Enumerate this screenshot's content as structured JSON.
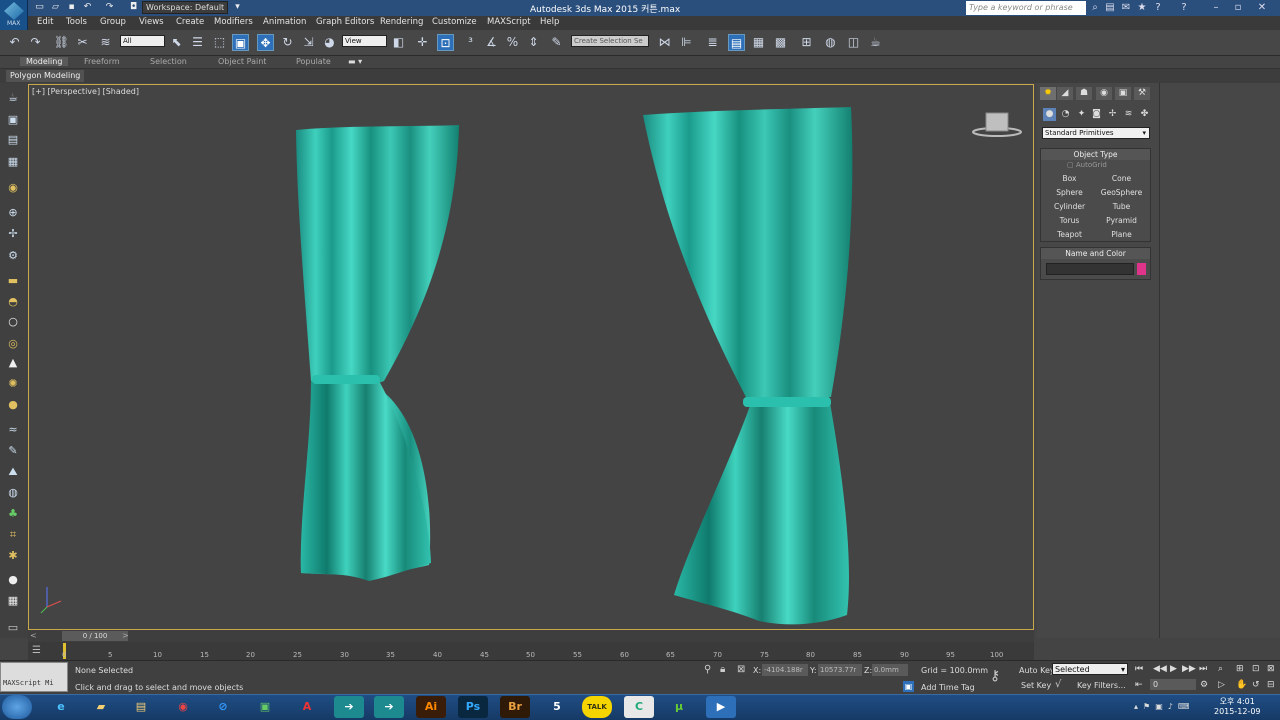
{
  "titlebar": {
    "app_icon_label": "MAX",
    "workspace": "Workspace: Default",
    "title": "Autodesk 3ds Max  2015     커튼.max",
    "search_placeholder": "Type a keyword or phrase"
  },
  "menubar": {
    "items": [
      "Edit",
      "Tools",
      "Group",
      "Views",
      "Create",
      "Modifiers",
      "Animation",
      "Graph Editors",
      "Rendering",
      "Customize",
      "MAXScript",
      "Help"
    ]
  },
  "toolbar": {
    "selection_filter": "All",
    "ref_coord": "View",
    "named_selection": "Create Selection Se"
  },
  "ribbon": {
    "tabs": [
      "Modeling",
      "Freeform",
      "Selection",
      "Object Paint",
      "Populate"
    ],
    "active_tab": "Modeling",
    "subtab": "Polygon Modeling"
  },
  "viewport": {
    "label": "[+] [Perspective] [Shaded]",
    "viewcube_label": "Right"
  },
  "command_panel": {
    "category": "Standard Primitives",
    "object_type_header": "Object Type",
    "autogrid": "AutoGrid",
    "buttons": [
      "Box",
      "Cone",
      "Sphere",
      "GeoSphere",
      "Cylinder",
      "Tube",
      "Torus",
      "Pyramid",
      "Teapot",
      "Plane"
    ],
    "name_color_header": "Name and Color",
    "swatch_color": "#e0338a"
  },
  "timeline": {
    "frame_indicator": "0 / 100",
    "ticks": [
      "0",
      "5",
      "10",
      "15",
      "20",
      "25",
      "30",
      "35",
      "40",
      "45",
      "50",
      "55",
      "60",
      "65",
      "70",
      "75",
      "80",
      "85",
      "90",
      "95",
      "100"
    ]
  },
  "status": {
    "selection": "None Selected",
    "prompt": "Click and drag to select and move objects",
    "maxscript": "MAXScript Mi",
    "x_label": "X:",
    "x_value": "-4104.188r",
    "y_label": "Y:",
    "y_value": "10573.77r",
    "z_label": "Z:",
    "z_value": "0.0mm",
    "grid": "Grid = 100.0mm",
    "add_time_tag": "Add Time Tag",
    "auto_key": "Auto Key",
    "key_mode": "Selected",
    "set_key": "Set Key",
    "key_filters": "Key Filters...",
    "frame_value": "0"
  },
  "taskbar": {
    "apps": [
      "IE",
      "Explorer",
      "Files",
      "Chrome",
      "Outlook",
      "Evernote",
      "Acrobat",
      "3ds",
      "3ds",
      "Ai",
      "Ps",
      "Br",
      "5",
      "Talk",
      "Camtasia",
      "uTorrent",
      "Media"
    ],
    "time": "오후 4:01",
    "date": "2015-12-09"
  }
}
